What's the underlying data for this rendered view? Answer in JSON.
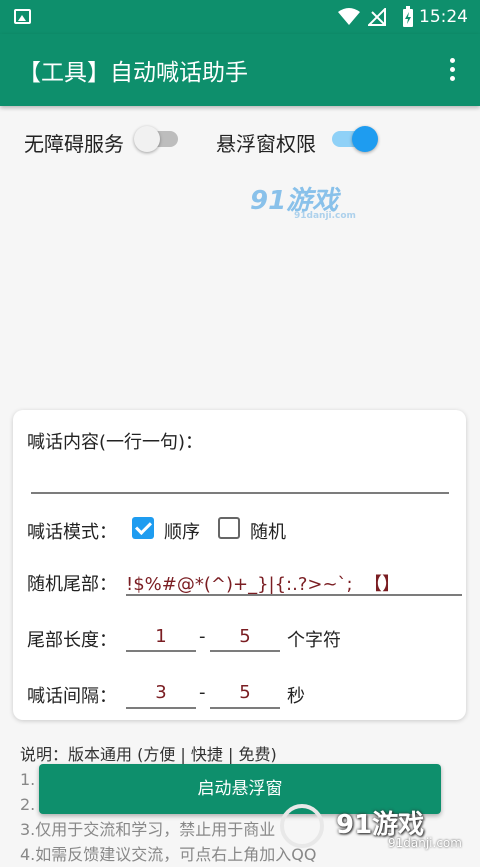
{
  "status_bar": {
    "time": "15:24"
  },
  "app_bar": {
    "title": "【工具】自动喊话助手"
  },
  "switches": {
    "accessibility": {
      "label": "无障碍服务",
      "on": false
    },
    "overlay": {
      "label": "悬浮窗权限",
      "on": true
    }
  },
  "watermark": {
    "brand": "91游戏",
    "domain": "91danji.com"
  },
  "form": {
    "content_label": "喊话内容(一行一句)：",
    "content_value": "",
    "mode_label": "喊话模式：",
    "mode_options": [
      {
        "label": "顺序",
        "checked": true
      },
      {
        "label": "随机",
        "checked": false
      }
    ],
    "tail_label": "随机尾部：",
    "tail_value": "!$%#@*(^)+_}|{:.?>~`;  【】",
    "tail_length_label": "尾部长度：",
    "tail_length_min": "1",
    "tail_length_max": "5",
    "tail_length_unit": "个字符",
    "interval_label": "喊话间隔：",
    "interval_min": "3",
    "interval_max": "5",
    "interval_unit": "秒",
    "range_sep": "-"
  },
  "notes": {
    "heading": "说明：版本通用 (方便 | 快捷 | 免费)",
    "lines": [
      "1.",
      "2.",
      "3.仅用于交流和学习，禁止用于商业",
      "4.如需反馈建议交流，可点右上角加入QQ"
    ]
  },
  "start_button": {
    "label": "启动悬浮窗"
  },
  "colors": {
    "primary": "#0e8f6c",
    "accent": "#1e9cf0",
    "value_text": "#7a1d22"
  }
}
